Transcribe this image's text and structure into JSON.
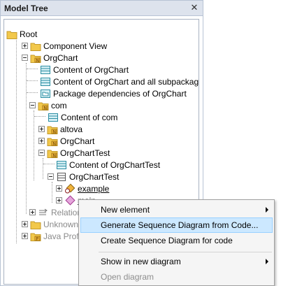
{
  "panel": {
    "title": "Model Tree",
    "close_label": "✕"
  },
  "tree": [
    {
      "label": "Root",
      "icon": "folder-icon",
      "dim": false
    },
    {
      "label": "Component View",
      "icon": "folder-icon",
      "dim": false
    },
    {
      "label": "OrgChart",
      "icon": "package-icon",
      "dim": false
    },
    {
      "label": "Content of OrgChart",
      "icon": "diagram-icon",
      "dim": false
    },
    {
      "label": "Content of OrgChart and all subpackages",
      "icon": "diagram-icon",
      "dim": false
    },
    {
      "label": "Package dependencies of OrgChart",
      "icon": "package-diagram-icon",
      "dim": false
    },
    {
      "label": "com",
      "icon": "package-icon",
      "dim": false
    },
    {
      "label": "Content of com",
      "icon": "diagram-icon",
      "dim": false
    },
    {
      "label": "altova",
      "icon": "package-icon",
      "dim": false
    },
    {
      "label": "OrgChart",
      "icon": "package-icon",
      "dim": false
    },
    {
      "label": "OrgChartTest",
      "icon": "package-icon",
      "dim": false
    },
    {
      "label": "Content of OrgChartTest",
      "icon": "diagram-icon",
      "dim": false
    },
    {
      "label": "OrgChartTest",
      "icon": "class-icon",
      "dim": false
    },
    {
      "label": "example",
      "icon": "property-icon",
      "dim": false
    },
    {
      "label": "main",
      "icon": "operation-icon",
      "dim": false
    },
    {
      "label": "Relation",
      "icon": "relations-icon",
      "dim": true
    },
    {
      "label": "Unknown",
      "icon": "folder-icon",
      "dim": true
    },
    {
      "label": "Java Profil",
      "icon": "profile-icon",
      "dim": true
    }
  ],
  "context_menu": {
    "items": [
      {
        "label": "New element",
        "submenu": true,
        "state": "normal"
      },
      {
        "label": "Generate Sequence Diagram from Code...",
        "submenu": false,
        "state": "hover"
      },
      {
        "label": "Create Sequence Diagram for code",
        "submenu": false,
        "state": "normal"
      },
      {
        "label": "Show in new diagram",
        "submenu": true,
        "state": "normal"
      },
      {
        "label": "Open diagram",
        "submenu": false,
        "state": "disabled"
      }
    ]
  },
  "colors": {
    "folder": "#f2c84b",
    "package_badge": "#f0b43c",
    "diagram": "#43b3c9",
    "hover_bg": "#cce8ff",
    "operation": "#c85ab4"
  }
}
